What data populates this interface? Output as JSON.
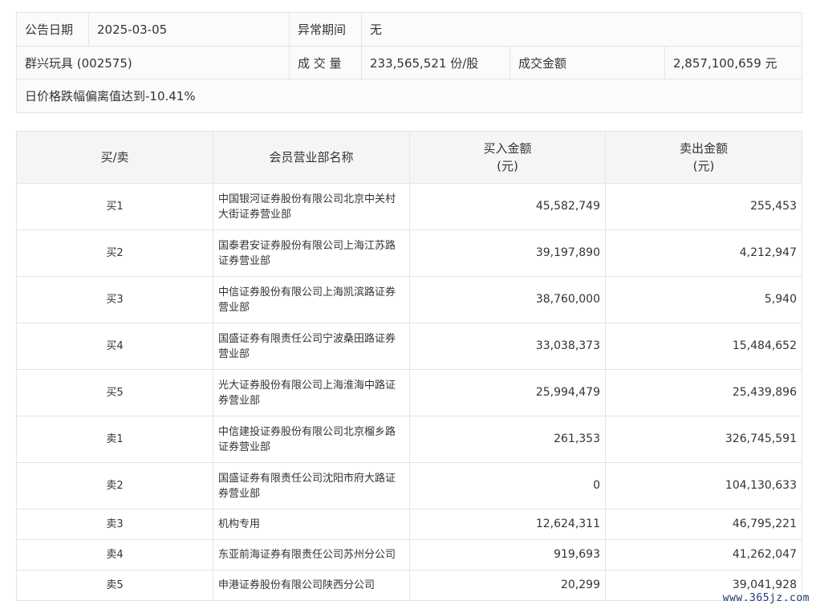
{
  "summary": {
    "date_label": "公告日期",
    "date_value": "2025-03-05",
    "period_label": "异常期间",
    "period_value": "无",
    "stock": "群兴玩具 (002575)",
    "volume_label": "成 交 量",
    "volume_value": "233,565,521 份/股",
    "amount_label": "成交金额",
    "amount_value": "2,857,100,659 元",
    "reason": "日价格跌幅偏离值达到-10.41%"
  },
  "table": {
    "headers": {
      "side": "买/卖",
      "name": "会员营业部名称",
      "buy_line1": "买入金额",
      "buy_line2": "(元)",
      "sell_line1": "卖出金额",
      "sell_line2": "(元)"
    },
    "rows": [
      {
        "side": "买1",
        "name_l1": "中国银河证券股份有限公司北京中关村",
        "name_l2": "大街证券营业部",
        "buy": "45,582,749",
        "sell": "255,453"
      },
      {
        "side": "买2",
        "name_l1": "国泰君安证券股份有限公司上海江苏路",
        "name_l2": "证券营业部",
        "buy": "39,197,890",
        "sell": "4,212,947"
      },
      {
        "side": "买3",
        "name_l1": "中信证券股份有限公司上海凯滨路证券",
        "name_l2": "营业部",
        "buy": "38,760,000",
        "sell": "5,940"
      },
      {
        "side": "买4",
        "name_l1": "国盛证券有限责任公司宁波桑田路证券",
        "name_l2": "营业部",
        "buy": "33,038,373",
        "sell": "15,484,652"
      },
      {
        "side": "买5",
        "name_l1": "光大证券股份有限公司上海淮海中路证",
        "name_l2": "券营业部",
        "buy": "25,994,479",
        "sell": "25,439,896"
      },
      {
        "side": "卖1",
        "name_l1": "中信建投证券股份有限公司北京榴乡路",
        "name_l2": "证券营业部",
        "buy": "261,353",
        "sell": "326,745,591"
      },
      {
        "side": "卖2",
        "name_l1": "国盛证券有限责任公司沈阳市府大路证",
        "name_l2": "券营业部",
        "buy": "0",
        "sell": "104,130,633"
      },
      {
        "side": "卖3",
        "name_l1": "机构专用",
        "name_l2": "",
        "buy": "12,624,311",
        "sell": "46,795,221"
      },
      {
        "side": "卖4",
        "name_l1": "东亚前海证券有限责任公司苏州分公司",
        "name_l2": "",
        "buy": "919,693",
        "sell": "41,262,047"
      },
      {
        "side": "卖5",
        "name_l1": "申港证券股份有限公司陕西分公司",
        "name_l2": "",
        "buy": "20,299",
        "sell": "39,041,928"
      }
    ]
  },
  "watermark": "www.365jz.com"
}
